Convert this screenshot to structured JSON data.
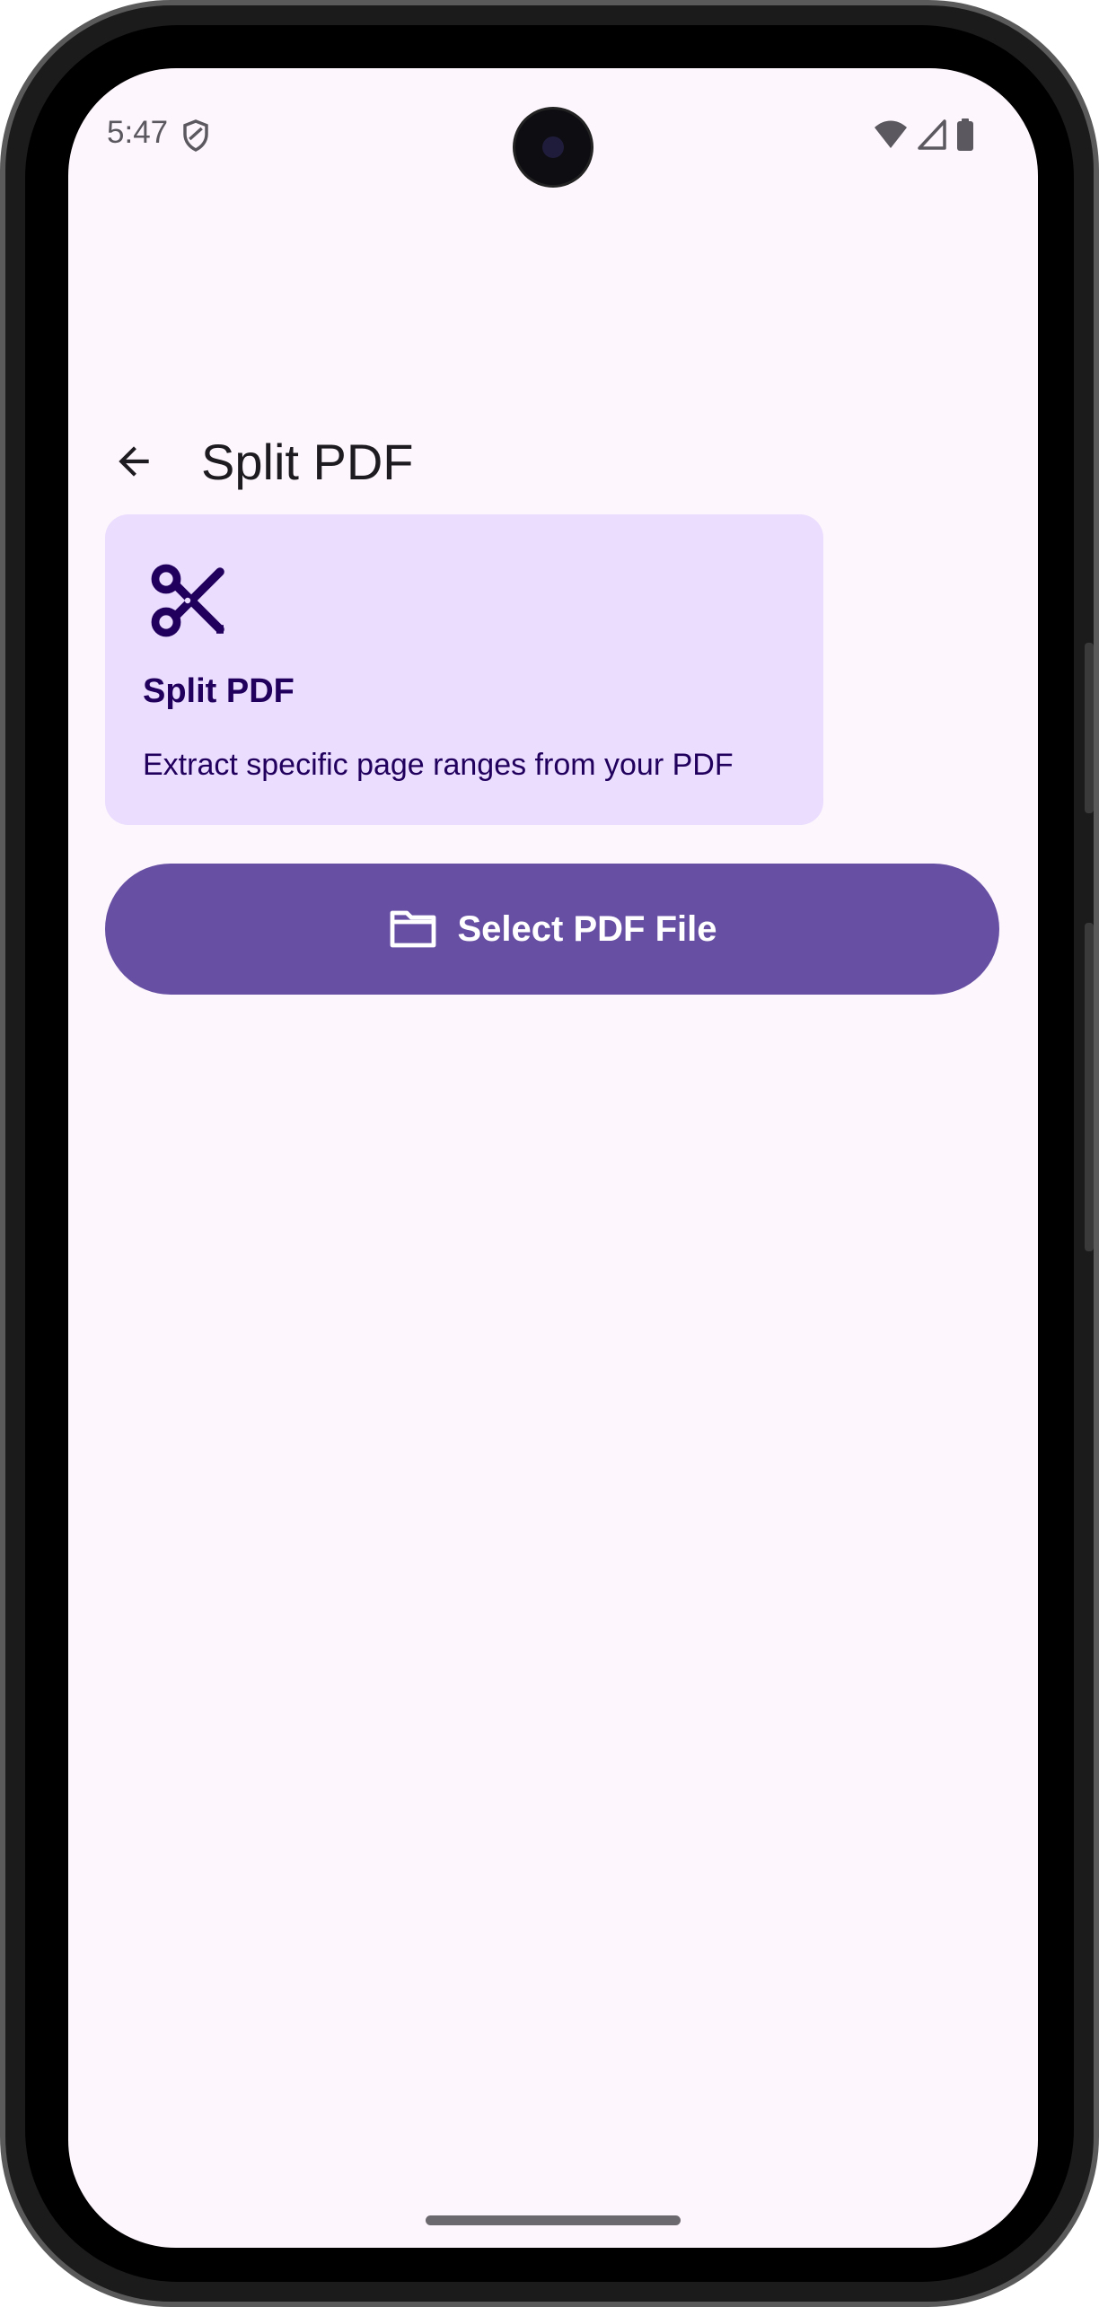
{
  "status_bar": {
    "time": "5:47",
    "icons": [
      "shield-icon",
      "wifi-icon",
      "cell-signal-icon",
      "battery-icon"
    ]
  },
  "app_bar": {
    "back_icon": "arrow-back-icon",
    "title": "Split PDF"
  },
  "info_card": {
    "icon": "scissors-icon",
    "title": "Split PDF",
    "description": "Extract specific page ranges from your PDF"
  },
  "primary_button": {
    "icon": "folder-icon",
    "label": "Select PDF File"
  },
  "colors": {
    "background": "#fdf6fc",
    "card": "#eaddfe",
    "card_text": "#21005d",
    "primary": "#6750a4",
    "on_primary": "#ffffff",
    "title_text": "#1d1b20"
  }
}
